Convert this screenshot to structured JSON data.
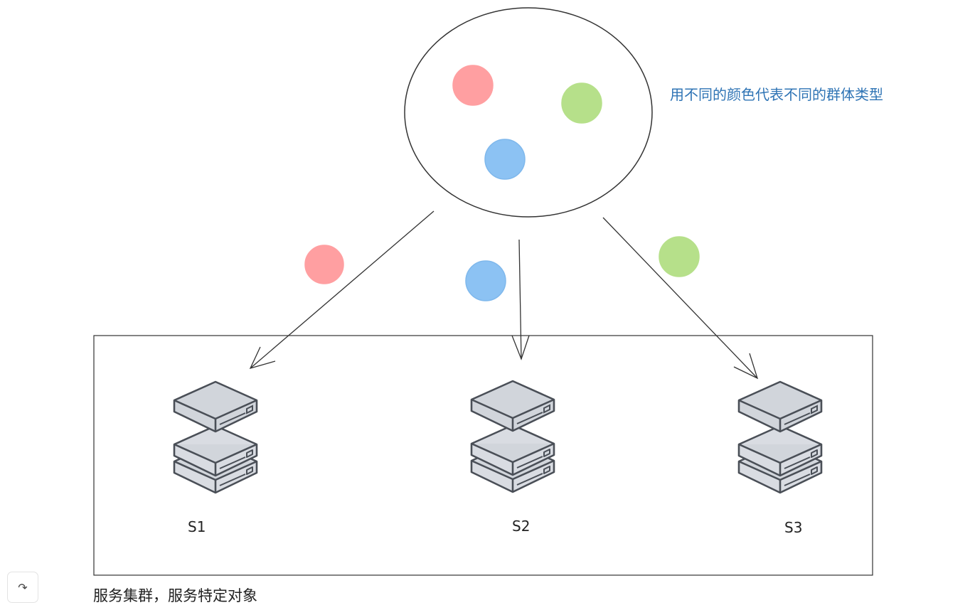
{
  "legend": {
    "text": "用不同的颜色代表不同的群体类型"
  },
  "servers": [
    {
      "label": "S1"
    },
    {
      "label": "S2"
    },
    {
      "label": "S3"
    }
  ],
  "caption": {
    "text": "服务集群，服务特定对象"
  },
  "colors": {
    "red": "#ff9fa1",
    "green": "#b6e08a",
    "blue": "#8cc2f3",
    "stroke": "#333333",
    "server_fill": "#cfd3da",
    "server_stroke": "#4a4f57"
  },
  "icons": {
    "share": "share-icon"
  }
}
